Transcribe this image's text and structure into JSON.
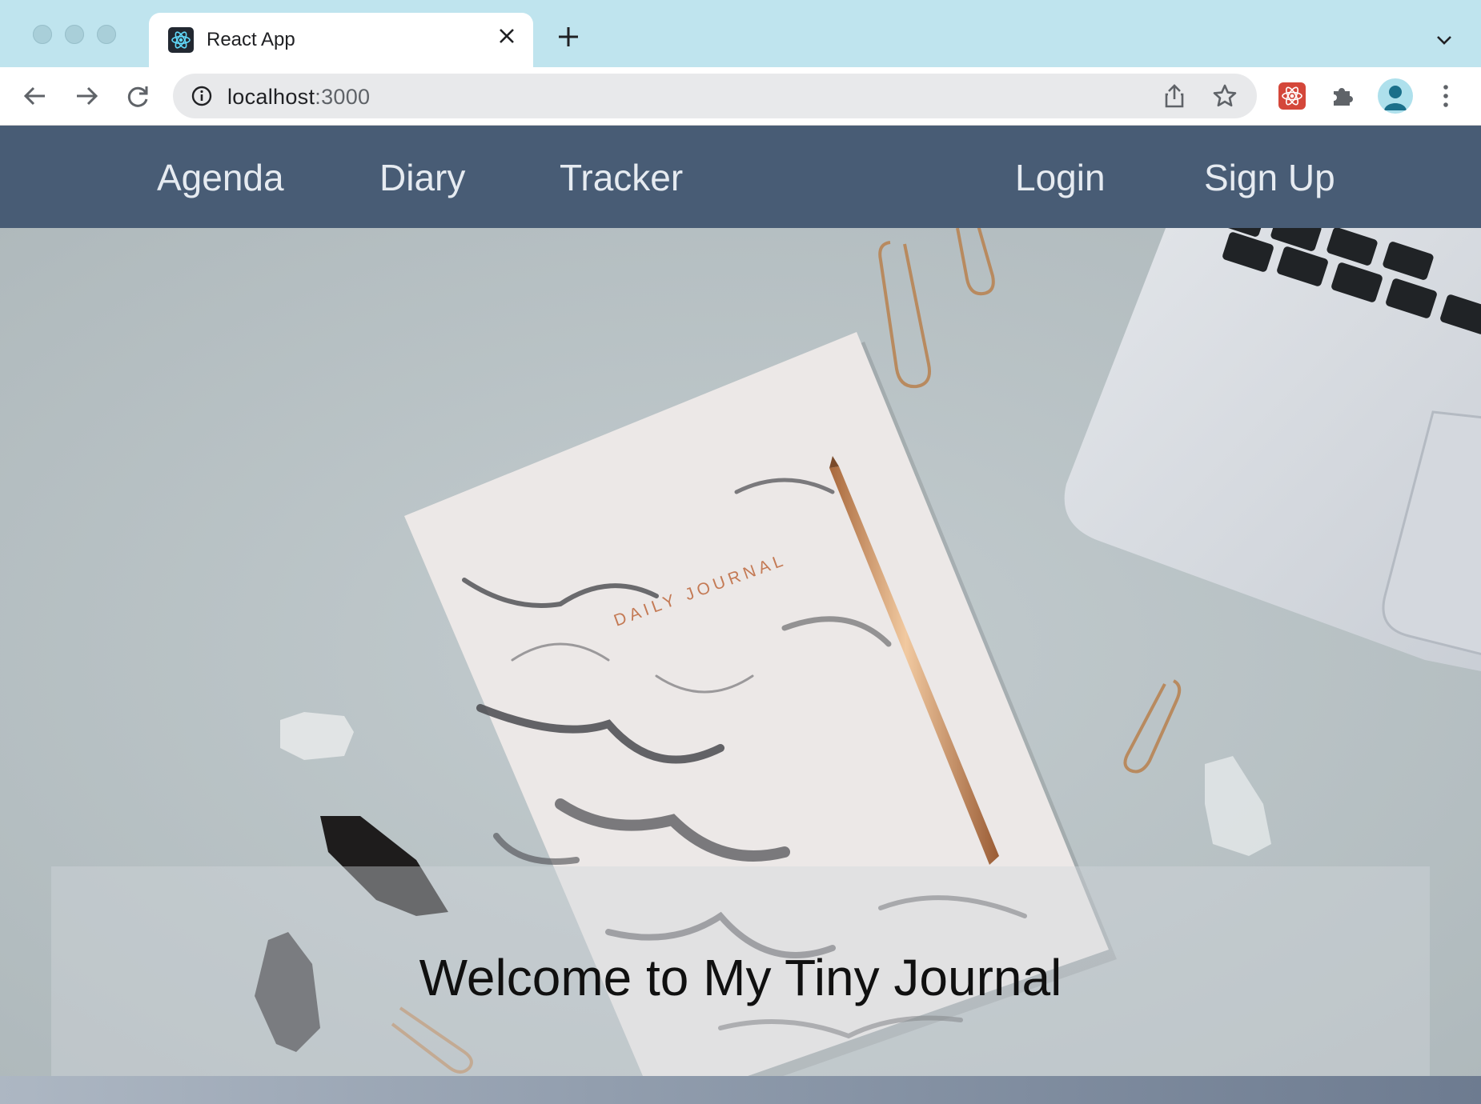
{
  "browser": {
    "tab_title": "React App",
    "url_host": "localhost",
    "url_port": ":3000"
  },
  "nav": {
    "left_links": [
      "Agenda",
      "Diary",
      "Tracker"
    ],
    "right_links": [
      "Login",
      "Sign Up"
    ],
    "background_color": "#485c75"
  },
  "hero": {
    "journal_cover_text": "DAILY JOURNAL",
    "welcome_text": "Welcome to My Tiny Journal"
  },
  "icons": {
    "back": "arrow-left-icon",
    "forward": "arrow-right-icon",
    "reload": "reload-icon",
    "info": "info-icon",
    "share": "share-icon",
    "bookmark": "star-icon",
    "extension": "react-devtools-icon",
    "extensions": "puzzle-icon",
    "profile": "avatar-icon",
    "menu": "kebab-menu-icon"
  }
}
